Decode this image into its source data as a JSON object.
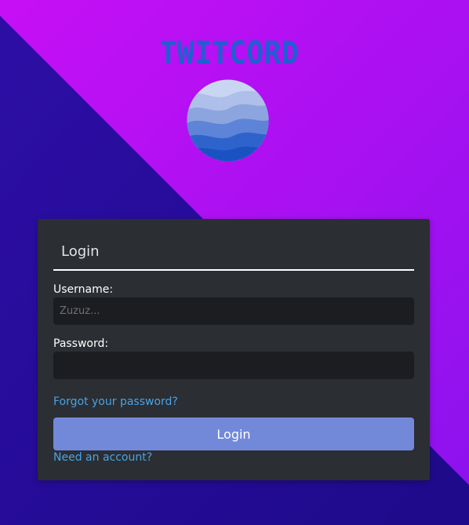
{
  "app": {
    "brand": "TWITCORD"
  },
  "login_card": {
    "title": "Login",
    "username_label": "Username:",
    "username_placeholder": "Zuzuz...",
    "username_value": "",
    "password_label": "Password:",
    "password_value": "",
    "forgot_link": "Forgot your password?",
    "submit_label": "Login",
    "register_link": "Need an account?"
  },
  "colors": {
    "background_dark": "#250c9c",
    "background_light": "#b40ff0",
    "brand_text": "#1f5fd0",
    "card": "#2b2e32",
    "input": "#1c1d20",
    "button": "#7289da",
    "link": "#4aa3e6"
  },
  "icons": {
    "logo": "wave-globe-icon"
  }
}
